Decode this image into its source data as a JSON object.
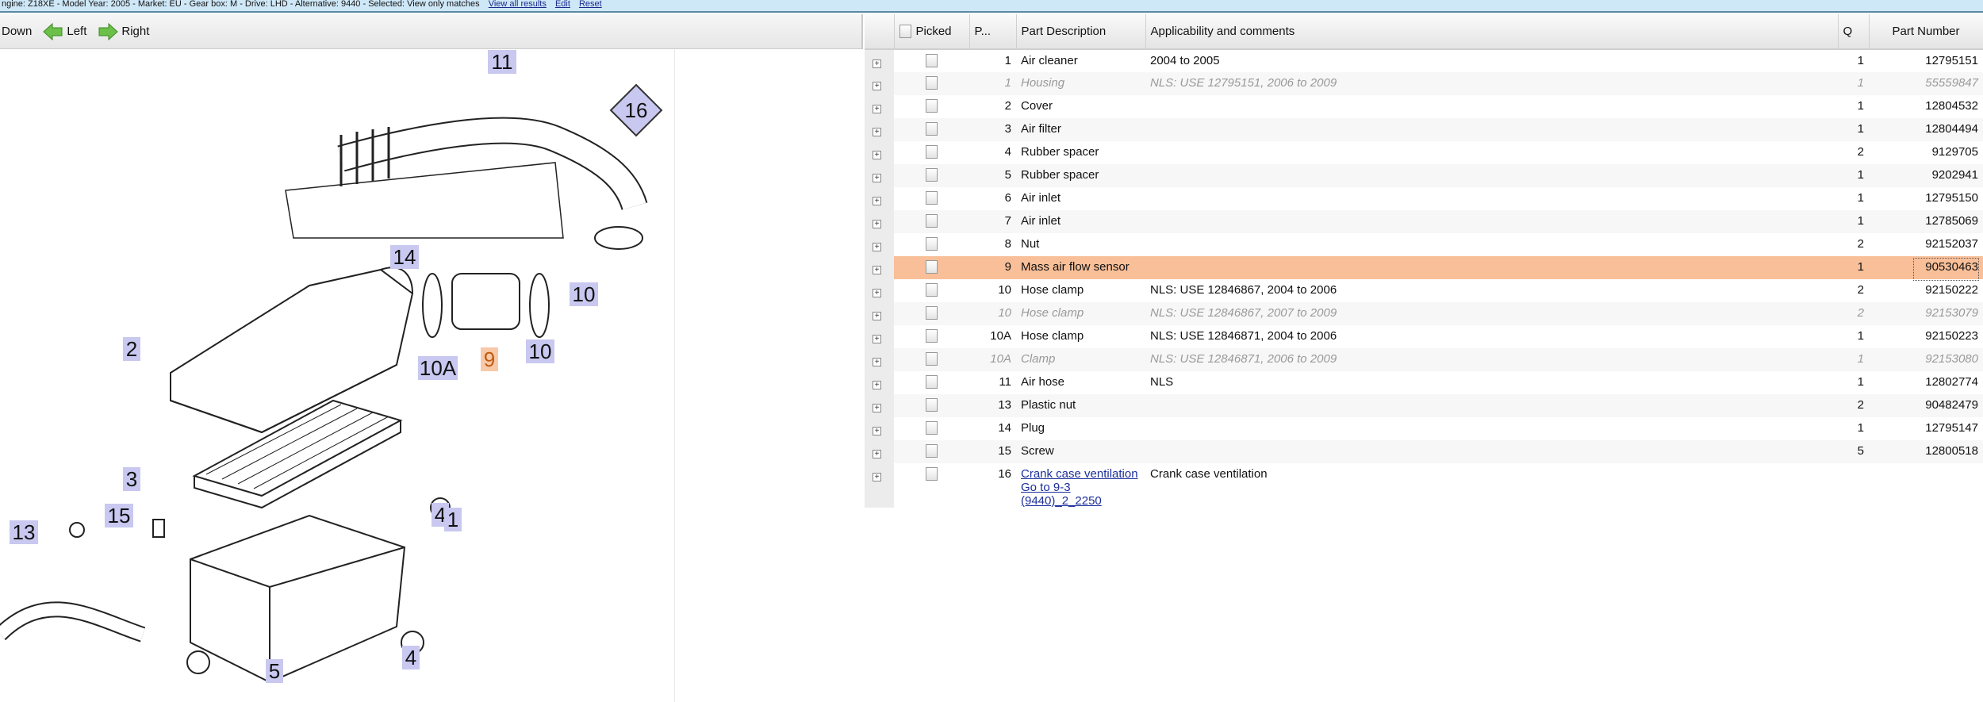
{
  "topbar": {
    "text": "ngine: Z18XE - Model Year: 2005 - Market: EU - Gear box: M - Drive: LHD - Alternative: 9440 - Selected: View only matches",
    "view_all": "View all results",
    "edit": "Edit",
    "reset": "Reset"
  },
  "toolbar": {
    "down": "Down",
    "left": "Left",
    "right": "Right"
  },
  "diagram": {
    "callouts": [
      "11",
      "16",
      "14",
      "10",
      "2",
      "10A",
      "9",
      "10",
      "3",
      "4",
      "1",
      "13",
      "15",
      "4",
      "5"
    ],
    "highlighted": "9"
  },
  "table": {
    "headers": {
      "picked": "Picked",
      "pos": "P...",
      "desc": "Part Description",
      "comments": "Applicability and comments",
      "qty": "Q",
      "part_number": "Part Number"
    },
    "rows": [
      {
        "pos": "1",
        "desc": "Air cleaner",
        "comments": "2004 to 2005",
        "qty": "1",
        "pn": "12795151"
      },
      {
        "pos": "1",
        "desc": "Housing",
        "comments": "NLS: USE 12795151, 2006 to 2009",
        "qty": "1",
        "pn": "55559847",
        "alt": true
      },
      {
        "pos": "2",
        "desc": "Cover",
        "comments": "",
        "qty": "1",
        "pn": "12804532"
      },
      {
        "pos": "3",
        "desc": "Air filter",
        "comments": "",
        "qty": "1",
        "pn": "12804494"
      },
      {
        "pos": "4",
        "desc": "Rubber spacer",
        "comments": "",
        "qty": "2",
        "pn": "9129705"
      },
      {
        "pos": "5",
        "desc": "Rubber spacer",
        "comments": "",
        "qty": "1",
        "pn": "9202941"
      },
      {
        "pos": "6",
        "desc": "Air inlet",
        "comments": "",
        "qty": "1",
        "pn": "12795150"
      },
      {
        "pos": "7",
        "desc": "Air inlet",
        "comments": "",
        "qty": "1",
        "pn": "12785069"
      },
      {
        "pos": "8",
        "desc": "Nut",
        "comments": "",
        "qty": "2",
        "pn": "92152037"
      },
      {
        "pos": "9",
        "desc": "Mass air flow sensor",
        "comments": "",
        "qty": "1",
        "pn": "90530463",
        "selected": true
      },
      {
        "pos": "10",
        "desc": "Hose clamp",
        "comments": "NLS: USE 12846867, 2004 to 2006",
        "qty": "2",
        "pn": "92150222"
      },
      {
        "pos": "10",
        "desc": "Hose clamp",
        "comments": "NLS: USE 12846867, 2007 to 2009",
        "qty": "2",
        "pn": "92153079",
        "alt": true
      },
      {
        "pos": "10A",
        "desc": "Hose clamp",
        "comments": "NLS: USE 12846871, 2004 to 2006",
        "qty": "1",
        "pn": "92150223"
      },
      {
        "pos": "10A",
        "desc": "Clamp",
        "comments": "NLS: USE 12846871, 2006 to 2009",
        "qty": "1",
        "pn": "92153080",
        "alt": true
      },
      {
        "pos": "11",
        "desc": "Air hose",
        "comments": "NLS",
        "qty": "1",
        "pn": "12802774"
      },
      {
        "pos": "13",
        "desc": "Plastic nut",
        "comments": "",
        "qty": "2",
        "pn": "90482479"
      },
      {
        "pos": "14",
        "desc": "Plug",
        "comments": "",
        "qty": "1",
        "pn": "12795147"
      },
      {
        "pos": "15",
        "desc": "Screw",
        "comments": "",
        "qty": "5",
        "pn": "12800518"
      },
      {
        "pos": "16",
        "desc": "Crank case ventilation Go to 9-3 (9440)_2_2250",
        "comments": "Crank case ventilation",
        "qty": "",
        "pn": "",
        "link": true
      }
    ]
  },
  "colors": {
    "selected_row": "#f8bf98",
    "callout_bg": "#c8c8f0",
    "callout_highlight": "#f8c9a8",
    "topbar": "#cfe8f8"
  }
}
